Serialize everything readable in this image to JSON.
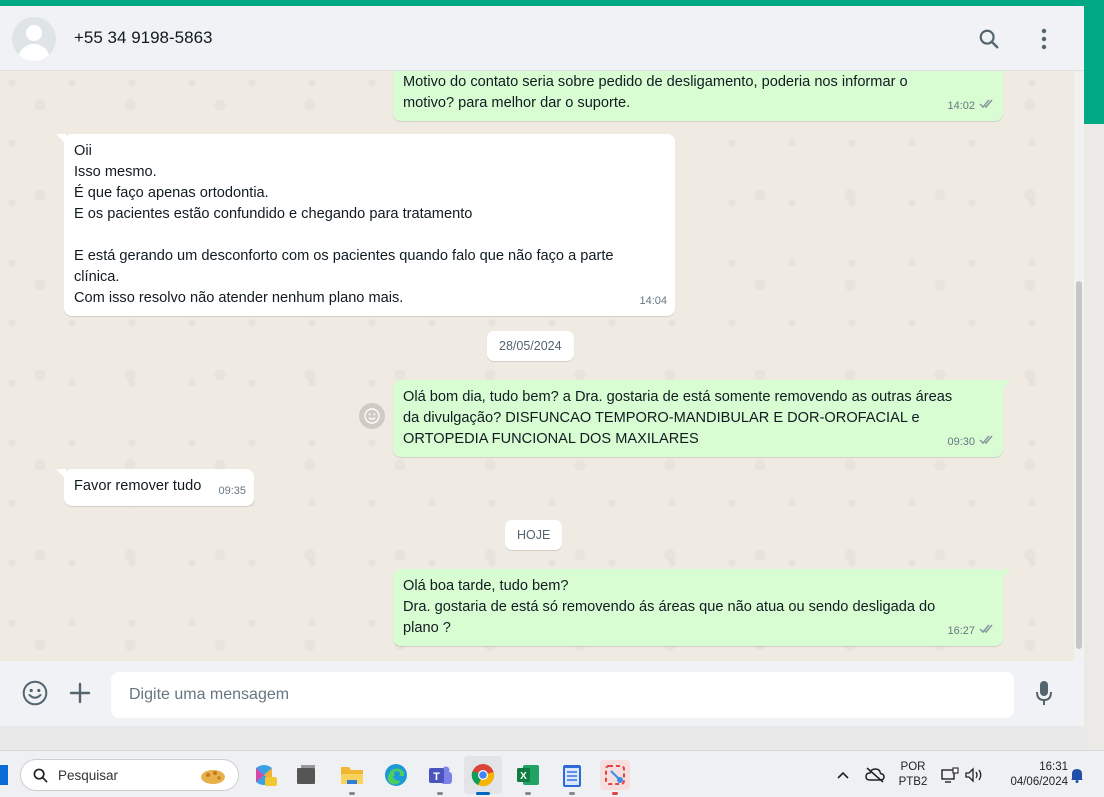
{
  "colors": {
    "accent": "#00a884",
    "outgoing_bubble": "#d9fdd3",
    "incoming_bubble": "#ffffff",
    "chat_bg": "#efeae2"
  },
  "header": {
    "contact_name": "+55 34 9198-5863",
    "icons": [
      "search-icon",
      "menu-kebab-icon"
    ]
  },
  "messages": [
    {
      "direction": "out",
      "text": "Motivo do contato seria sobre pedido de desligamento, poderia nos informar o\nmotivo? para melhor dar o suporte.",
      "time": "14:02",
      "status": "read"
    },
    {
      "direction": "in",
      "text": "Oii\nIsso mesmo.\nÉ que faço apenas ortodontia.\nE os pacientes estão confundido e chegando para tratamento\n\nE está gerando um desconforto com os pacientes quando falo que não faço a parte\nclínica.\nCom isso resolvo não atender nenhum plano mais.",
      "time": "14:04"
    },
    {
      "direction": "out",
      "text": "Olá bom dia, tudo bem? a Dra. gostaria de está somente removendo as outras áreas\nda divulgação? DISFUNCAO TEMPORO-MANDIBULAR E DOR-OROFACIAL e\nORTOPEDIA FUNCIONAL DOS MAXILARES",
      "time": "09:30",
      "status": "read"
    },
    {
      "direction": "in",
      "text": "Favor remover tudo",
      "time": "09:35"
    },
    {
      "direction": "out",
      "text": "Olá boa tarde, tudo bem?\nDra. gostaria de está só removendo ás áreas que não atua ou sendo desligada do\nplano ?",
      "time": "16:27",
      "status": "read"
    }
  ],
  "date_separators": [
    "28/05/2024",
    "HOJE"
  ],
  "composer": {
    "placeholder": "Digite uma mensagem",
    "icons": [
      "emoji-icon",
      "plus-icon",
      "microphone-icon"
    ]
  },
  "taskbar": {
    "search_label": "Pesquisar",
    "apps": [
      "copilot-icon",
      "task-view-icon",
      "file-explorer-icon",
      "edge-icon",
      "teams-icon",
      "chrome-icon",
      "excel-icon",
      "notepad-icon",
      "snipping-tool-icon"
    ],
    "tray": {
      "language": "POR",
      "layout": "PTB2",
      "time": "16:31",
      "date": "04/06/2024"
    }
  }
}
